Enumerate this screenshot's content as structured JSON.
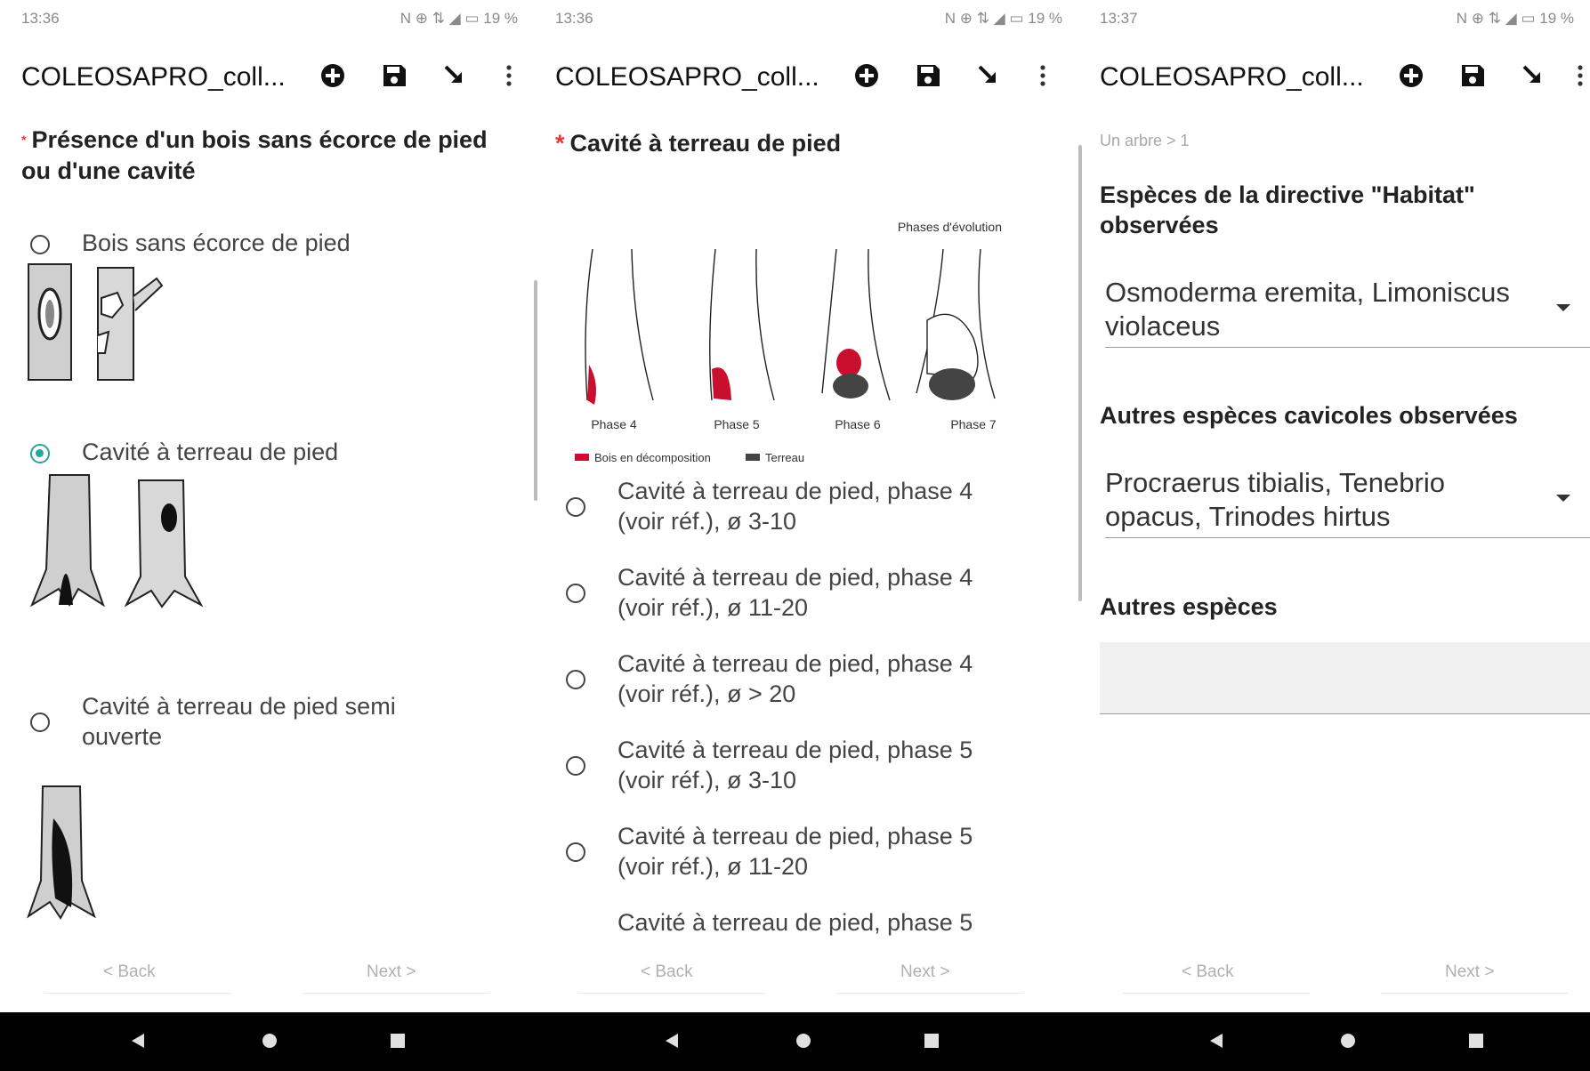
{
  "panels": [
    {
      "status": {
        "time": "13:36",
        "right": "N ⊕ ⇅ ◢ ▭ 19 %"
      },
      "title": "COLEOSAPRO_coll...",
      "question": "Présence d'un bois sans écorce de pied ou d'une cavité",
      "options": [
        {
          "label": "Bois sans écorce de pied",
          "selected": false
        },
        {
          "label": "Cavité à terreau de pied",
          "selected": true
        },
        {
          "label": "Cavité à terreau de pied semi ouverte",
          "selected": false
        }
      ],
      "back": "< Back",
      "next": "Next >"
    },
    {
      "status": {
        "time": "13:36",
        "right": "N ⊕ ⇅ ◢ ▭ 19 %"
      },
      "title": "COLEOSAPRO_coll...",
      "question": "Cavité à terreau de pied",
      "figure": {
        "heading": "Phases d'évolution",
        "phases": [
          "Phase 4",
          "Phase 5",
          "Phase 6",
          "Phase 7"
        ],
        "legend": [
          {
            "label": "Bois en décomposition",
            "color": "#c8102e"
          },
          {
            "label": "Terreau",
            "color": "#444444"
          }
        ]
      },
      "options": [
        {
          "label": "Cavité à terreau de pied, phase 4 (voir réf.), ø 3-10"
        },
        {
          "label": "Cavité à terreau de pied, phase 4 (voir réf.), ø 11-20"
        },
        {
          "label": "Cavité à terreau de pied, phase 4 (voir réf.), ø > 20"
        },
        {
          "label": "Cavité à terreau de pied, phase 5 (voir réf.), ø 3-10"
        },
        {
          "label": "Cavité à terreau de pied, phase 5 (voir réf.), ø 11-20"
        },
        {
          "label": "Cavité à terreau de pied, phase 5"
        }
      ],
      "back": "< Back",
      "next": "Next >"
    },
    {
      "status": {
        "time": "13:37",
        "right": "N ⊕ ⇅ ◢ ▭ 19 %"
      },
      "title": "COLEOSAPRO_coll...",
      "breadcrumb": "Un arbre > 1",
      "sections": [
        {
          "label": "Espèces de la directive \"Habitat\" observées",
          "value": "Osmoderma eremita, Limoniscus violaceus"
        },
        {
          "label": "Autres espèces cavicoles observées",
          "value": "Procraerus tibialis, Tenebrio opacus, Trinodes hirtus"
        },
        {
          "label": "Autres espèces",
          "value": ""
        }
      ],
      "back": "< Back",
      "next": "Next >"
    }
  ],
  "colors": {
    "accent": "#26a69a",
    "required": "#e53935",
    "decay": "#c8102e"
  }
}
